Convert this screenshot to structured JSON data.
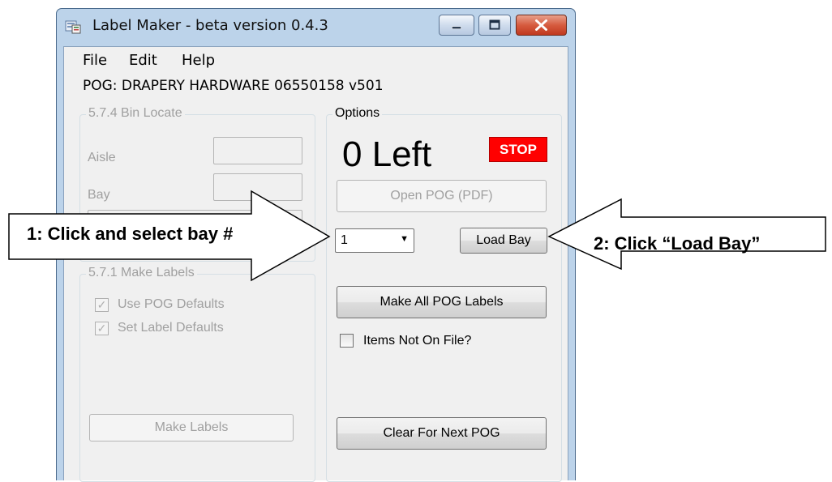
{
  "window": {
    "title": "Label Maker - beta version 0.4.3",
    "controls": {
      "minimize": "minimize",
      "maximize": "maximize",
      "close": "close"
    }
  },
  "menu": {
    "items": [
      "File",
      "Edit",
      "Help"
    ]
  },
  "pog_label": "POG: DRAPERY HARDWARE 06550158 v501",
  "bin_locate": {
    "legend": "5.7.4 Bin Locate",
    "aisle_label": "Aisle",
    "bay_label": "Bay"
  },
  "make_labels": {
    "legend": "5.7.1 Make Labels",
    "use_pog_defaults": "Use POG Defaults",
    "set_label_defaults": "Set Label Defaults",
    "make_labels_button": "Make Labels"
  },
  "options": {
    "legend": "Options",
    "left_count": "0 Left",
    "stop": "STOP",
    "open_pog_button": "Open POG (PDF)",
    "bay_select_value": "1",
    "load_bay_button": "Load Bay",
    "make_all_button": "Make All POG Labels",
    "items_not_on_file": "Items Not On File?",
    "clear_button": "Clear For Next POG"
  },
  "callouts": {
    "left": "1: Click and select bay #",
    "right": "2: Click “Load Bay”"
  },
  "colors": {
    "stop_bg": "#ff0000",
    "titlebar": "#bcd3ea",
    "close_button": "#d65b3f"
  }
}
